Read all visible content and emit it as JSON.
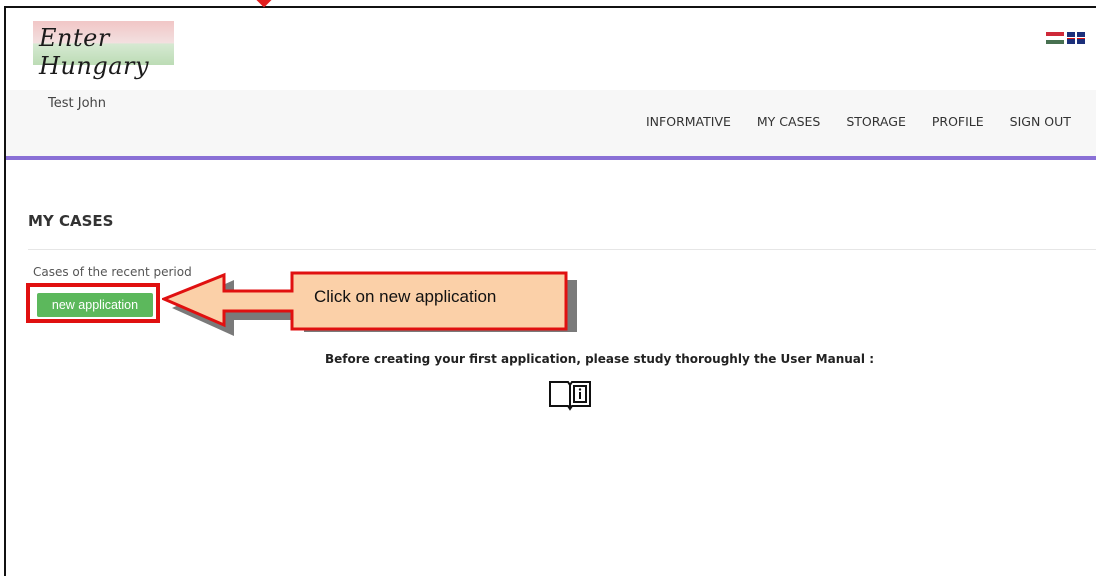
{
  "header": {
    "logo_text": "Enter Hungary"
  },
  "navbar": {
    "user_name": "Test John",
    "items": [
      {
        "label": "INFORMATIVE"
      },
      {
        "label": "MY CASES"
      },
      {
        "label": "STORAGE"
      },
      {
        "label": "PROFILE"
      },
      {
        "label": "SIGN OUT"
      }
    ]
  },
  "main": {
    "title": "MY CASES",
    "recent_label": "Cases of the recent period",
    "new_application_label": "new application",
    "manual_text": "Before creating your first application, please study thoroughly the User Manual :"
  },
  "annotation": {
    "callout_text": "Click on new application",
    "highlight_color": "#e01010",
    "callout_fill": "#fbd0a8"
  },
  "colors": {
    "accent": "#8a70d6",
    "button": "#5cb85c"
  }
}
